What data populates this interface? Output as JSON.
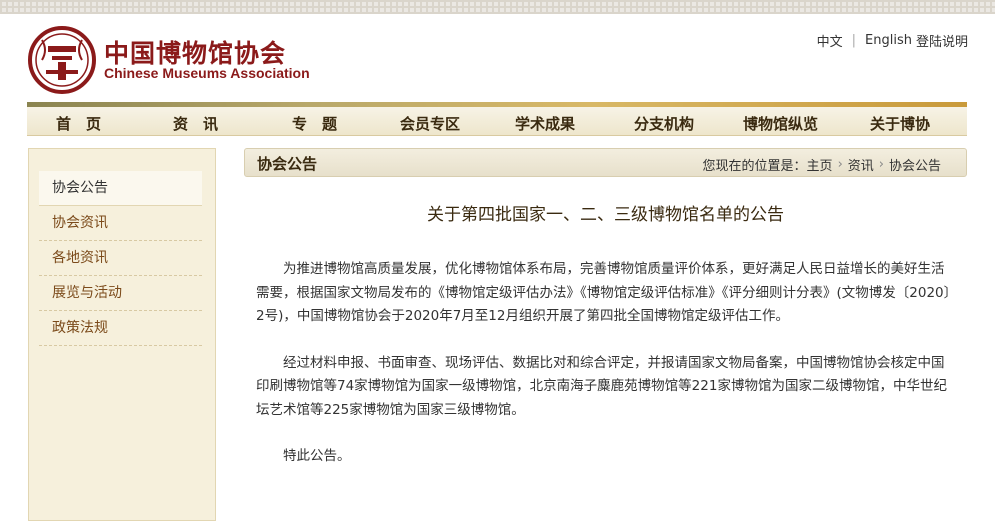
{
  "header": {
    "org_name_cn": "中国博物馆协会",
    "org_name_en": "Chinese Museums Association",
    "lang_cn": "中文",
    "lang_en": "English",
    "login_help": "登陆说明"
  },
  "nav": {
    "items": [
      "首　页",
      "资　讯",
      "专　题",
      "会员专区",
      "学术成果",
      "分支机构",
      "博物馆纵览",
      "关于博协"
    ]
  },
  "sidebar": {
    "items": [
      {
        "label": "协会公告",
        "active": true
      },
      {
        "label": "协会资讯",
        "active": false
      },
      {
        "label": "各地资讯",
        "active": false
      },
      {
        "label": "展览与活动",
        "active": false
      },
      {
        "label": "政策法规",
        "active": false
      }
    ]
  },
  "breadcrumb": {
    "section_title": "协会公告",
    "prefix": "您现在的位置是：",
    "path": [
      "主页",
      "资讯",
      "协会公告"
    ]
  },
  "article": {
    "title": "关于第四批国家一、二、三级博物馆名单的公告",
    "paragraphs": [
      "为推进博物馆高质量发展，优化博物馆体系布局，完善博物馆质量评价体系，更好满足人民日益增长的美好生活需要，根据国家文物局发布的《博物馆定级评估办法》《博物馆定级评估标准》《评分细则计分表》(文物博发〔2020〕2号)，中国博物馆协会于2020年7月至12月组织开展了第四批全国博物馆定级评估工作。",
      "经过材料申报、书面审查、现场评估、数据比对和综合评定，并报请国家文物局备案，中国博物馆协会核定中国印刷博物馆等74家博物馆为国家一级博物馆，北京南海子麋鹿苑博物馆等221家博物馆为国家二级博物馆，中华世纪坛艺术馆等225家博物馆为国家三级博物馆。",
      "特此公告。"
    ]
  },
  "colors": {
    "brand_red": "#8b1a1a",
    "sidebar_bg": "#f6f0dc",
    "nav_text": "#3a2a10"
  }
}
